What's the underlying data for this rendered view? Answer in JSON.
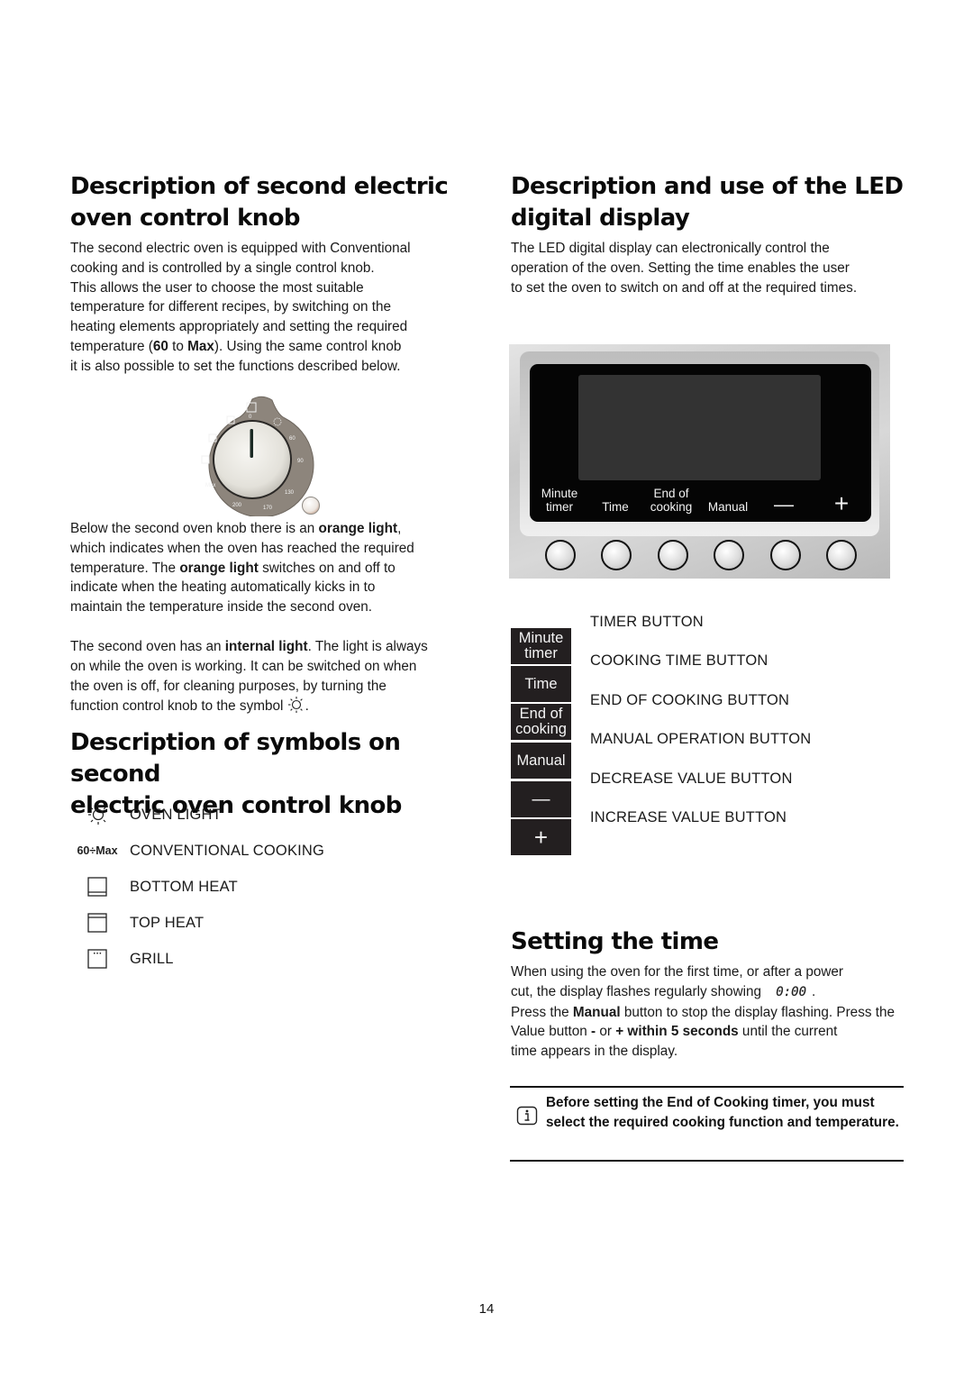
{
  "left_column": {
    "knob_section": {
      "title_line1": "Description of second electric",
      "title_line2": "oven control knob",
      "paragraph": [
        "The second electric oven is equipped with Conventional",
        "cooking and is controlled by a single control knob.",
        "This allows the user to choose the most suitable",
        "temperature for different recipes, by switching on the",
        "heating elements appropriately and setting the required"
      ],
      "last_line_parts": {
        "a": "temperature (",
        "b_bold": "60",
        "c": " to ",
        "d_bold": "Max",
        "e": "). Using the same control knob"
      },
      "final_line": "it is also possible to set the functions described below."
    },
    "knob_image": {
      "markings": [
        "0",
        "60",
        "90",
        "130",
        "170",
        "200",
        "Max"
      ],
      "indicator_light": "orange light"
    },
    "orange_light_paragraph": {
      "l1a": "Below the second oven knob there is an ",
      "l1b_bold": "orange light",
      "l1c": ",",
      "l2": "which indicates when the oven has reached the required",
      "l3a": "temperature. The ",
      "l3b_bold": "orange light",
      "l3c": " switches on and off to",
      "l4": "indicate when the heating automatically kicks in to",
      "l5": "maintain the temperature inside the second oven."
    },
    "internal_light_paragraph": {
      "l1a": "The second oven has an ",
      "l1b_bold": "internal light",
      "l1c": ". The light is always",
      "l2": "on while the oven is working. It can be switched on when",
      "l3": "the oven is off, for cleaning purposes, by turning the",
      "l4": "function control knob to the symbol",
      "l4_end": "."
    },
    "symbols_section": {
      "title_line1": "Description of symbols on second",
      "title_line2": "electric oven control knob",
      "items": [
        {
          "icon": "oven-light-icon",
          "label": "OVEN LIGHT"
        },
        {
          "icon": "temperature-range",
          "range_text": "60÷Max",
          "label": "CONVENTIONAL COOKING"
        },
        {
          "icon": "bottom-heat-icon",
          "label": "BOTTOM HEAT"
        },
        {
          "icon": "top-heat-icon",
          "label": "TOP HEAT"
        },
        {
          "icon": "grill-icon",
          "label": "GRILL"
        }
      ]
    }
  },
  "right_column": {
    "led_section": {
      "title_line1": "Description and use of the LED",
      "title_line2": "digital display",
      "paragraph": [
        "The LED digital display can electronically control the",
        "operation of the oven. Setting the time enables the user",
        "to set the oven to switch on and off at the required times."
      ]
    },
    "panel": {
      "labels": [
        {
          "line1": "Minute",
          "line2": "timer"
        },
        {
          "line1": "",
          "line2": "Time"
        },
        {
          "line1": "End of",
          "line2": "cooking"
        },
        {
          "line1": "",
          "line2": "Manual"
        },
        {
          "line1": "",
          "line2": "—"
        },
        {
          "line1": "",
          "line2": "+"
        }
      ],
      "button_count": 6
    },
    "button_legend": [
      {
        "key_line1": "Minute",
        "key_line2": "timer",
        "label": "TIMER BUTTON"
      },
      {
        "key_line1": "Time",
        "key_line2": "",
        "label": "COOKING TIME BUTTON"
      },
      {
        "key_line1": "End of",
        "key_line2": "cooking",
        "label": "END OF COOKING BUTTON"
      },
      {
        "key_line1": "Manual",
        "key_line2": "",
        "label": "MANUAL OPERATION BUTTON"
      },
      {
        "key_line1": "—",
        "key_line2": "",
        "label": "DECREASE VALUE BUTTON"
      },
      {
        "key_line1": "+",
        "key_line2": "",
        "label": "INCREASE VALUE BUTTON"
      }
    ],
    "setting_time": {
      "title": "Setting the time",
      "l1": "When using the oven for the first time, or after a power",
      "l2": "cut, the display flashes regularly showing",
      "display_value": "0:00",
      "l2_end": ".",
      "l3a": "Press the ",
      "l3b_bold": "Manual",
      "l3c": " button to stop the display flashing. Press the",
      "l4a": "Value button ",
      "l4b_bold": "-",
      "l4c": " or ",
      "l4d_bold": "+ within 5 seconds",
      "l4e": " until the current",
      "l5": "time appears in the display."
    },
    "note": {
      "icon": "info-icon",
      "text": "Before setting the End of Cooking timer, you must select the required cooking function and temperature."
    }
  },
  "page_number": "14"
}
